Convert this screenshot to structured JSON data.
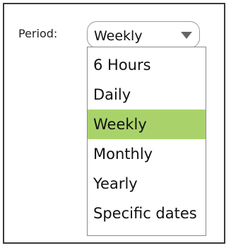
{
  "period": {
    "label": "Period:",
    "selected_value": "Weekly",
    "selected_index": 2,
    "options": [
      "6 Hours",
      "Daily",
      "Weekly",
      "Monthly",
      "Yearly",
      "Specific dates"
    ]
  },
  "icons": {
    "dropdown_arrow": "chevron-down-icon"
  },
  "colors": {
    "selected_bg": "#a9d36a",
    "border": "#3a3a3a",
    "select_border": "#9a9a9a"
  }
}
